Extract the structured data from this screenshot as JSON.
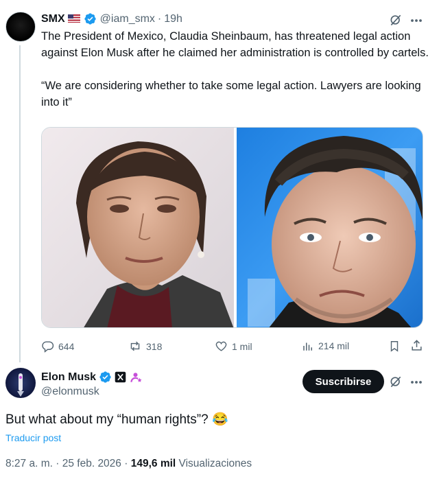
{
  "quoted_tweet": {
    "author_name": "SMX",
    "author_handle": "@iam_smx",
    "separator": "·",
    "time": "19h",
    "text_p1": "The President of Mexico, Claudia Sheinbaum, has threatened legal action against Elon Musk after he claimed her administration is controlled by cartels.",
    "text_p2": "“We are considering whether to take some legal action. Lawyers are looking into it”",
    "stats": {
      "replies": "644",
      "reposts": "318",
      "likes": "1 mil",
      "views": "214 mil"
    }
  },
  "reply_tweet": {
    "author_name": "Elon Musk",
    "author_handle": "@elonmusk",
    "follow_label": "Suscribirse",
    "text": "But what about my “human rights”? 😂",
    "translate_label": "Traducir post",
    "time": "8:27 a. m.",
    "date_sep": "·",
    "date": "25 feb. 2026",
    "views_count": "149,6 mil",
    "views_label": "Visualizaciones"
  },
  "colors": {
    "accent": "#1d9bf0",
    "muted": "#536471",
    "text": "#0f1419",
    "verified": "#1d9bf0",
    "grok_purple": "#c64fd9"
  },
  "icons": [
    "grok-icon",
    "more-icon",
    "reply-icon",
    "repost-icon",
    "like-icon",
    "views-icon",
    "bookmark-icon",
    "share-icon",
    "verified-icon",
    "x-badge-icon",
    "affiliate-icon"
  ]
}
